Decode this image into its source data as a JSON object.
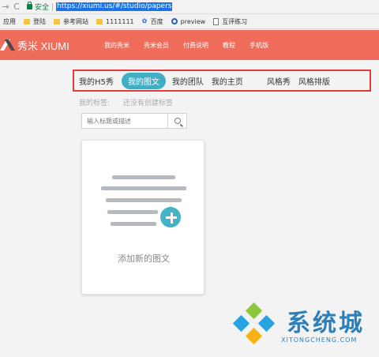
{
  "browser": {
    "secure_label": "安全",
    "url": "https://xiumi.us/#/studio/papers"
  },
  "bookmarks": {
    "apps": "应用",
    "items": [
      "登陆",
      "参考网站",
      "1111111",
      "百度",
      "preview",
      "互评练习"
    ]
  },
  "header": {
    "logo_text": "秀米 XIUMI",
    "nav": [
      "我的秀米",
      "秀米会员",
      "付费说明",
      "教程",
      "手机版"
    ]
  },
  "tabs": [
    "我的H5秀",
    "我的图文",
    "我的团队",
    "我的主页",
    "风格秀",
    "风格排版"
  ],
  "active_tab": "我的图文",
  "tags": {
    "label": "我的标签:",
    "value": "还没有创建标签"
  },
  "search": {
    "placeholder": "输入标题或描述"
  },
  "card": {
    "label": "添加新的图文"
  },
  "watermark": {
    "title": "系统城",
    "domain": "XITONGCHENG.COM"
  },
  "colors": {
    "header": "#f06c5b",
    "accent": "#41afc3",
    "highlight_border": "#e23b3b"
  }
}
